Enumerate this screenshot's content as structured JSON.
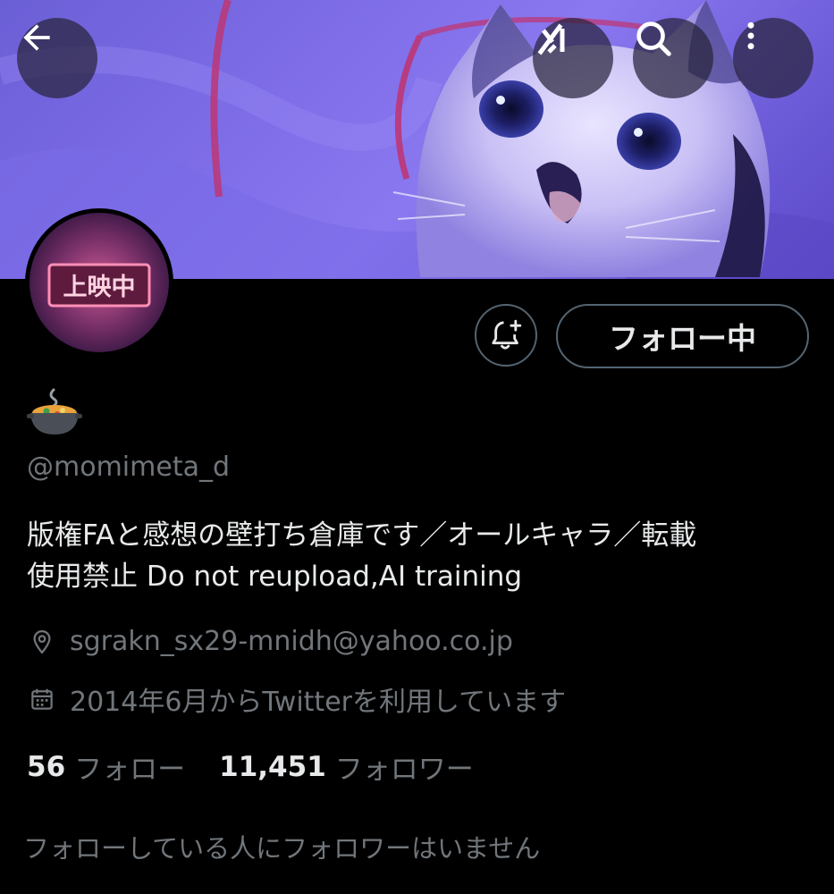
{
  "header": {
    "back_icon": "arrow-left-icon",
    "grok_icon": "grok-icon",
    "search_icon": "search-icon",
    "more_icon": "more-vertical-icon"
  },
  "banner": {
    "description_icon": "cat-photo-banner"
  },
  "avatar": {
    "sign_text": "上映中"
  },
  "actions": {
    "notify_icon": "bell-plus-icon",
    "follow_label": "フォロー中"
  },
  "profile": {
    "display_name_emoji": "🍲",
    "handle": "@momimeta_d",
    "bio_line1": "版権FAと感想の壁打ち倉庫です／オールキャラ／転載",
    "bio_line2": "使用禁止 Do not reupload,AI training",
    "location": "sgrakn_sx29-mnidh@yahoo.co.jp",
    "joined": "2014年6月からTwitterを利用しています"
  },
  "stats": {
    "following_count": "56",
    "following_label": "フォロー",
    "followers_count": "11,451",
    "followers_label": "フォロワー"
  },
  "followers_you_know": "フォローしている人にフォロワーはいません",
  "colors": {
    "background": "#000000",
    "text_primary": "#e7e9ea",
    "text_secondary": "#71767b",
    "border": "#536471"
  }
}
